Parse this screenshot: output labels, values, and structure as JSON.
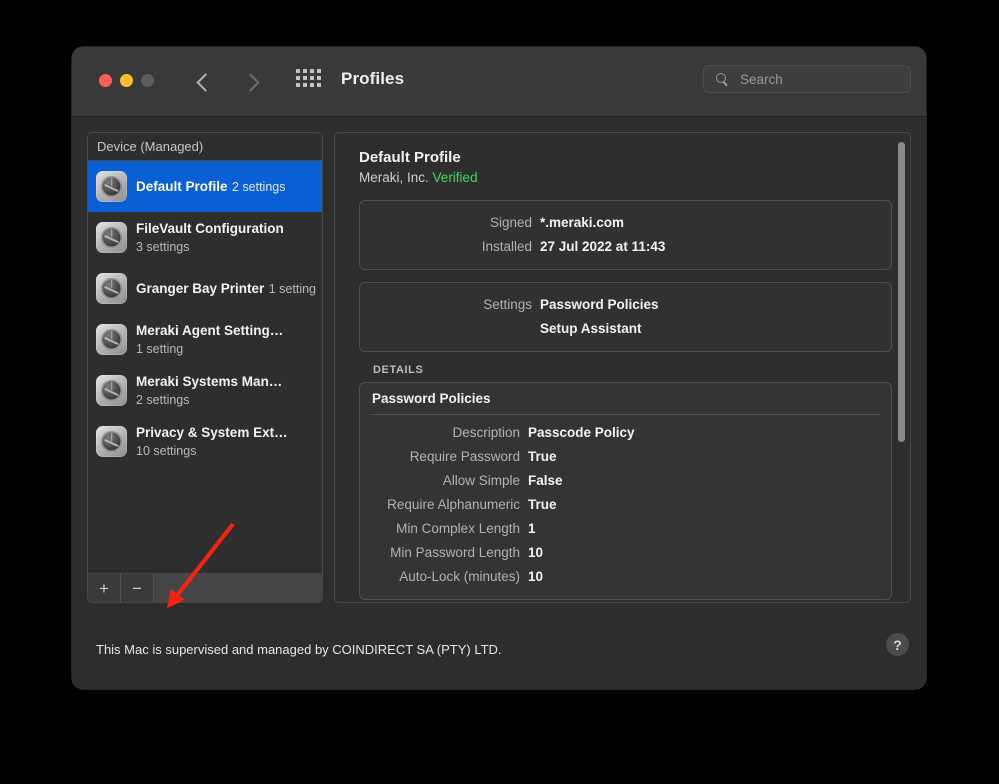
{
  "window": {
    "title": "Profiles",
    "traffic_lights": [
      "close",
      "minimize",
      "zoom"
    ],
    "back_label": "Back",
    "forward_label": "Forward",
    "grid_label": "Show All Preferences"
  },
  "search": {
    "placeholder": "Search",
    "value": "",
    "icon": "search-icon"
  },
  "sidebar": {
    "header": "Device (Managed)",
    "add_label": "+",
    "remove_label": "−",
    "items": [
      {
        "name": "Default Profile",
        "sub": "2 settings",
        "selected": true,
        "icon": "profile-icon"
      },
      {
        "name": "FileVault Configuration",
        "sub": "3 settings",
        "selected": false,
        "icon": "profile-icon"
      },
      {
        "name": "Granger Bay Printer",
        "sub": "1 setting",
        "selected": false,
        "icon": "profile-icon"
      },
      {
        "name": "Meraki Agent Setting…",
        "sub": "1 setting",
        "selected": false,
        "icon": "profile-icon"
      },
      {
        "name": "Meraki Systems Man…",
        "sub": "2 settings",
        "selected": false,
        "icon": "profile-icon"
      },
      {
        "name": "Privacy & System Ext…",
        "sub": "10 settings",
        "selected": false,
        "icon": "profile-icon"
      }
    ]
  },
  "detail": {
    "title": "Default Profile",
    "organization": "Meraki, Inc.",
    "verified": "Verified",
    "info_rows": [
      {
        "key": "Signed",
        "value": "*.meraki.com"
      },
      {
        "key": "Installed",
        "value": "27 Jul 2022 at 11:43"
      }
    ],
    "settings_rows": [
      {
        "key": "Settings",
        "value": "Password Policies"
      },
      {
        "key": "",
        "value": "Setup Assistant"
      }
    ],
    "details_section_label": "DETAILS",
    "details_card": {
      "title": "Password Policies",
      "rows": [
        {
          "key": "Description",
          "value": "Passcode Policy"
        },
        {
          "key": "Require Password",
          "value": "True"
        },
        {
          "key": "Allow Simple",
          "value": "False"
        },
        {
          "key": "Require Alphanumeric",
          "value": "True"
        },
        {
          "key": "Min Complex Length",
          "value": "1"
        },
        {
          "key": "Min Password Length",
          "value": "10"
        },
        {
          "key": "Auto-Lock (minutes)",
          "value": "10"
        }
      ]
    }
  },
  "footer": {
    "text": "This Mac is supervised and managed by COINDIRECT SA (PTY) LTD.",
    "help_label": "?"
  },
  "colors": {
    "selection_blue": "#0a5fd4",
    "verified_green": "#44d860",
    "annotation_red": "#f42314",
    "window_bg": "#2d2d2d",
    "titlebar_bg": "#393939"
  }
}
